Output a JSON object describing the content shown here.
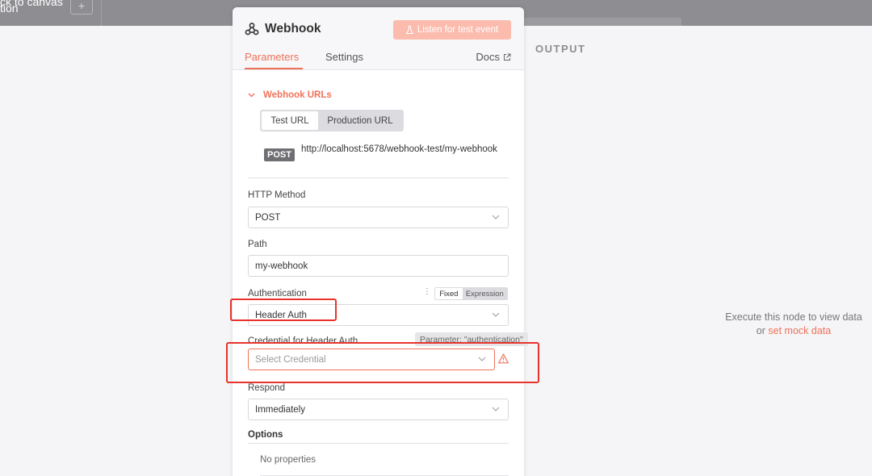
{
  "topbar": {
    "back_label": "ck to canvas",
    "back_label_2": "tion",
    "plus": "+"
  },
  "output": {
    "label": "OUTPUT",
    "message": "Execute this node to view data",
    "message_prefix": "or",
    "mock_link": "set mock data"
  },
  "panel": {
    "title": "Webhook",
    "listen_button": "Listen for test event",
    "tabs": [
      "Parameters",
      "Settings"
    ],
    "docs": "Docs",
    "webhook_urls": {
      "heading": "Webhook URLs",
      "toggle": [
        "Test URL",
        "Production URL"
      ],
      "method_badge": "POST",
      "url": "http://localhost:5678/webhook-test/my-webhook"
    },
    "http_method": {
      "label": "HTTP Method",
      "value": "POST"
    },
    "path": {
      "label": "Path",
      "value": "my-webhook"
    },
    "authentication": {
      "label": "Authentication",
      "value": "Header Auth",
      "mode_toggle": [
        "Fixed",
        "Expression"
      ]
    },
    "credential": {
      "label": "Credential for Header Auth",
      "placeholder": "Select Credential",
      "tooltip": "Parameter: \"authentication\""
    },
    "respond": {
      "label": "Respond",
      "value": "Immediately"
    },
    "options": {
      "label": "Options",
      "empty": "No properties"
    }
  },
  "colors": {
    "accent": "#f07159",
    "annotation": "#e8322c",
    "topbar": "#8e8e92"
  }
}
